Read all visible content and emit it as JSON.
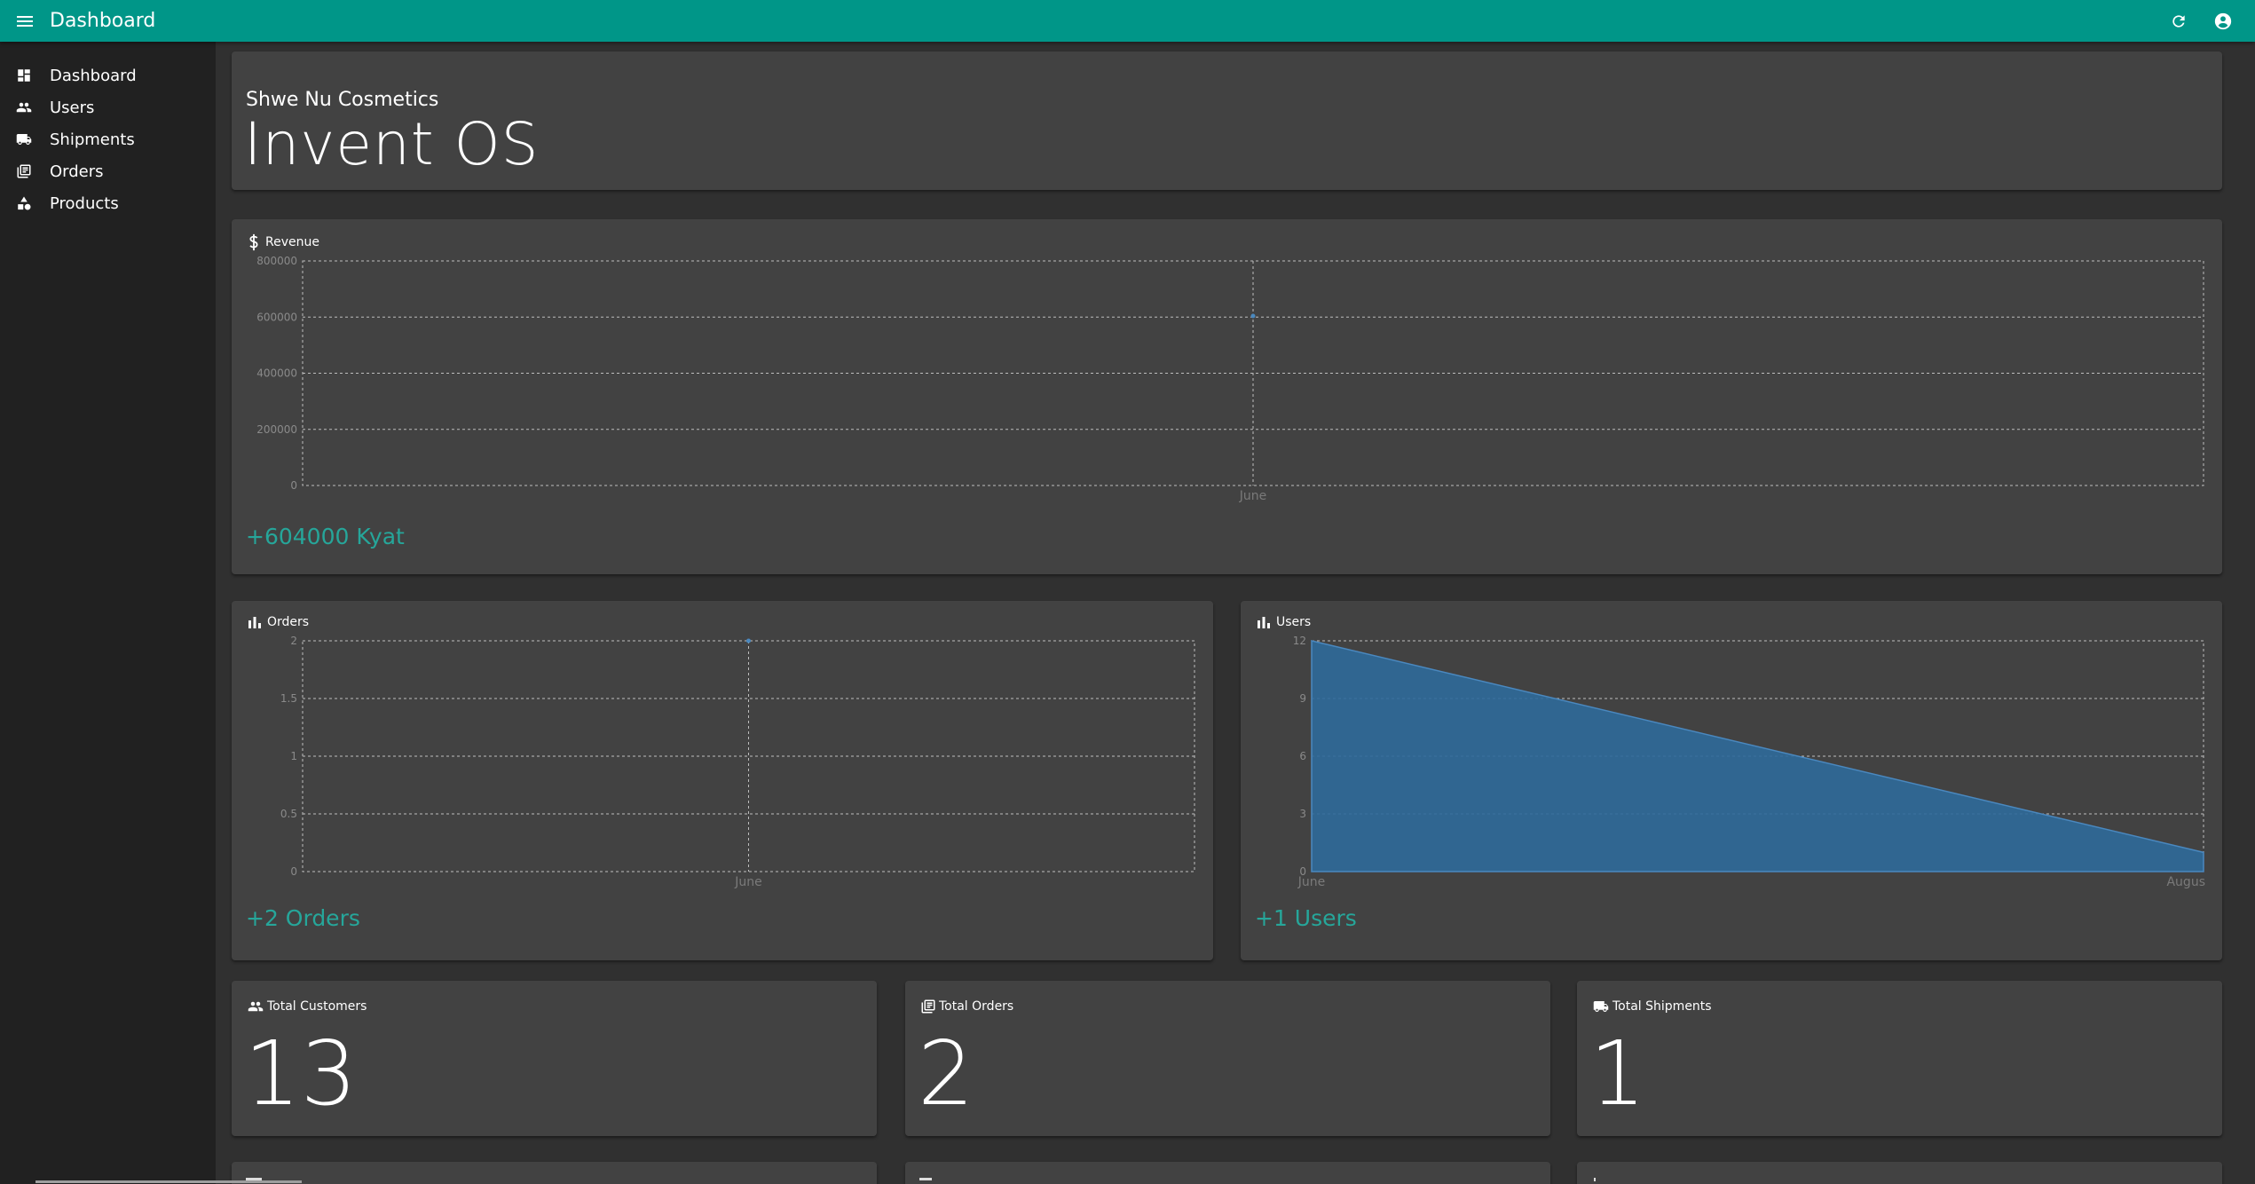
{
  "topbar": {
    "title": "Dashboard",
    "accent": "#009688"
  },
  "sidebar": {
    "items": [
      {
        "label": "Dashboard",
        "icon": "dashboard-icon"
      },
      {
        "label": "Users",
        "icon": "users-icon"
      },
      {
        "label": "Shipments",
        "icon": "truck-icon"
      },
      {
        "label": "Orders",
        "icon": "library-icon"
      },
      {
        "label": "Products",
        "icon": "shapes-icon"
      }
    ]
  },
  "header": {
    "subtitle": "Shwe Nu Cosmetics",
    "title": "Invent OS"
  },
  "charts": {
    "revenue": {
      "heading": "Revenue",
      "summary": "+604000 Kyat"
    },
    "orders": {
      "heading": "Orders",
      "summary": "+2 Orders"
    },
    "users": {
      "heading": "Users",
      "summary": "+1 Users"
    }
  },
  "stats": {
    "customers": {
      "label": "Total Customers",
      "value": "13"
    },
    "orders": {
      "label": "Total Orders",
      "value": "2"
    },
    "shipments": {
      "label": "Total Shipments",
      "value": "1"
    }
  },
  "colors": {
    "summary": "#26a69a",
    "series": "#2f6a9a",
    "series_line": "#4a88bf"
  },
  "chart_data": [
    {
      "type": "line",
      "title": "Revenue",
      "categories": [
        "June"
      ],
      "series": [
        {
          "values": [
            604000
          ]
        }
      ],
      "yticks": [
        "800000",
        "600000",
        "400000",
        "200000",
        "0"
      ],
      "ylim": [
        0,
        800000
      ],
      "grid": true
    },
    {
      "type": "line",
      "title": "Orders",
      "categories": [
        "June"
      ],
      "series": [
        {
          "values": [
            2
          ]
        }
      ],
      "yticks": [
        "2",
        "1.5",
        "1",
        "0.5",
        "0"
      ],
      "ylim": [
        0,
        2
      ],
      "grid": true
    },
    {
      "type": "area",
      "title": "Users",
      "categories": [
        "June",
        "Augus"
      ],
      "series": [
        {
          "values": [
            12,
            1
          ]
        }
      ],
      "yticks": [
        "12",
        "9",
        "6",
        "3",
        "0"
      ],
      "ylim": [
        0,
        12
      ],
      "grid": true
    }
  ]
}
